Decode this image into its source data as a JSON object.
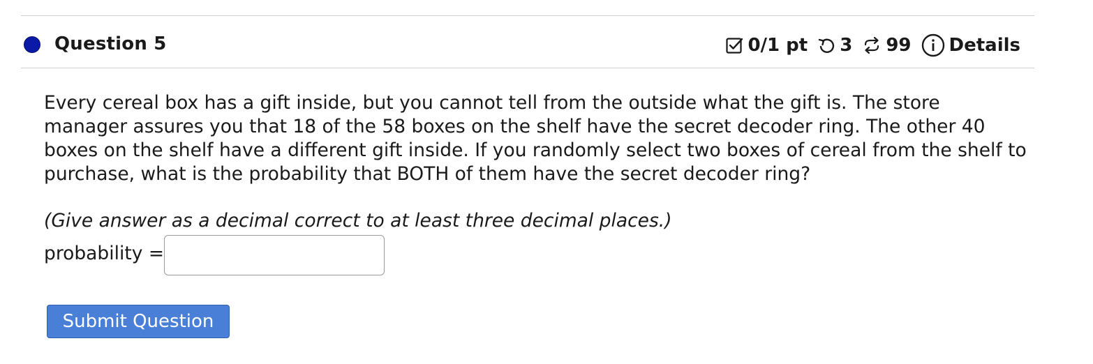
{
  "question": {
    "title": "Question 5",
    "score": "0/1 pt",
    "retries": "3",
    "attempts": "99",
    "details_label": "Details",
    "prompt": "Every cereal box has a gift inside, but you cannot tell from the outside what the gift is. The store manager assures you that 18 of the 58 boxes on the shelf have the secret decoder ring. The other 40 boxes on the shelf have a different gift inside. If you randomly select two boxes of cereal from the shelf to purchase, what is the probability that BOTH of them have the secret decoder ring?",
    "hint": "(Give answer as a decimal correct to at least three decimal places.)",
    "answer_label": "probability =",
    "answer_value": "",
    "submit_label": "Submit Question"
  },
  "icons": {
    "status": "filled-circle-icon",
    "score": "checkbox-icon",
    "retry": "undo-icon",
    "attempts": "repeat-icon",
    "details": "info-icon"
  },
  "colors": {
    "status_dot": "#0b1aa6",
    "button_bg": "#4a7fd8",
    "button_text": "#ffffff"
  }
}
